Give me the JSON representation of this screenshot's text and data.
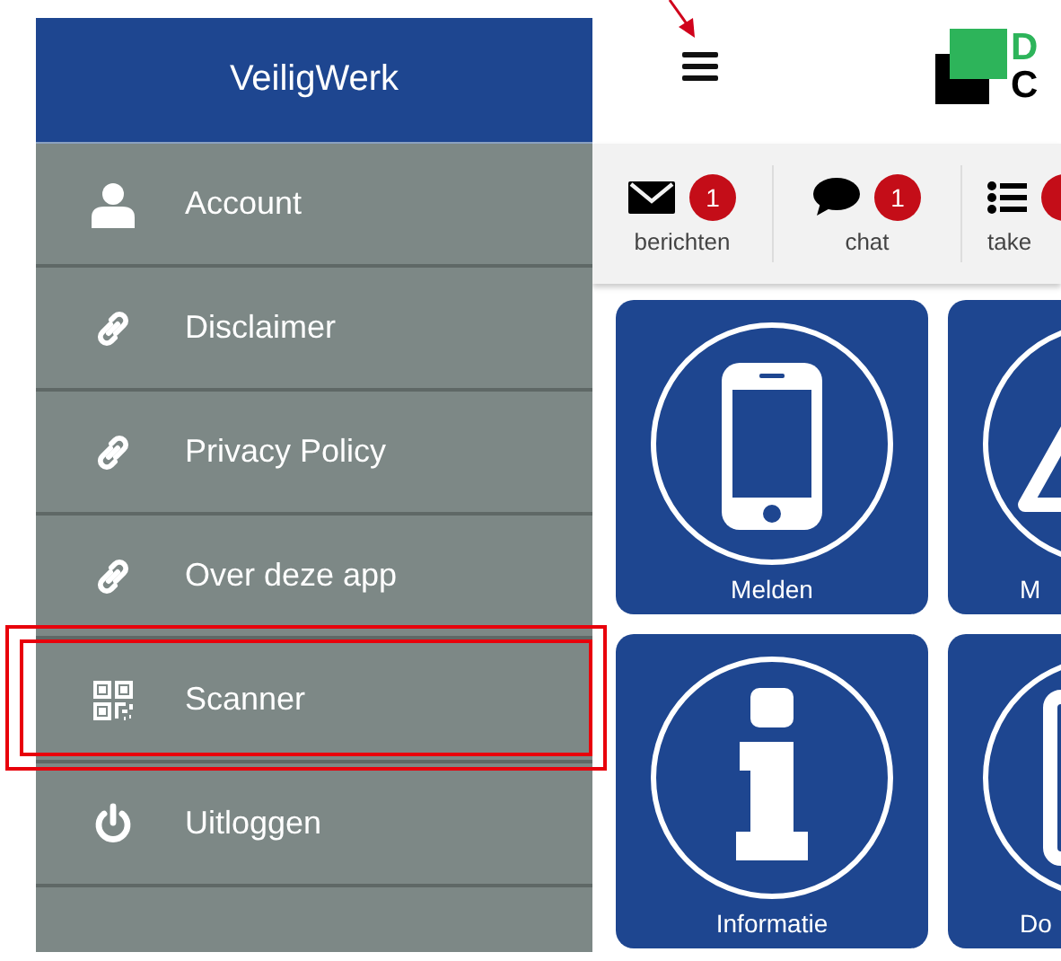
{
  "sidebar": {
    "title": "VeiligWerk",
    "items": [
      {
        "kind": "user",
        "label": "Account"
      },
      {
        "kind": "link",
        "label": "Disclaimer"
      },
      {
        "kind": "link",
        "label": "Privacy Policy"
      },
      {
        "kind": "link",
        "label": "Over deze app"
      },
      {
        "kind": "qr",
        "label": "Scanner",
        "highlighted": true
      },
      {
        "kind": "power",
        "label": "Uitloggen"
      }
    ]
  },
  "topbar": {
    "logo_letters": [
      "D",
      "C"
    ]
  },
  "tabs": [
    {
      "kind": "mail",
      "label": "berichten",
      "badge_shown": true,
      "badge_count": "1"
    },
    {
      "kind": "chat",
      "label": "chat",
      "badge_shown": true,
      "badge_count": "1"
    },
    {
      "kind": "list",
      "label": "take",
      "badge_shown": true
    }
  ],
  "tiles": [
    {
      "kind": "phone",
      "label": "Melden"
    },
    {
      "kind": "warning",
      "label": "M"
    },
    {
      "kind": "info",
      "label": "Informatie"
    },
    {
      "kind": "document",
      "label": "Do"
    }
  ]
}
